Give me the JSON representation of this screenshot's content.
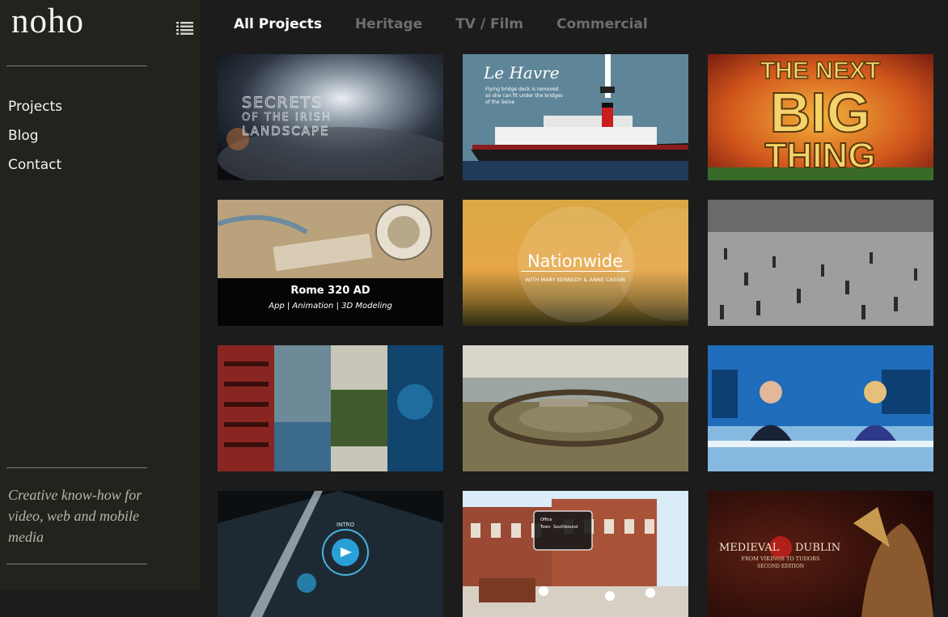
{
  "brand": {
    "logo_text": "noho"
  },
  "sidebar": {
    "nav": [
      {
        "label": "Projects"
      },
      {
        "label": "Blog"
      },
      {
        "label": "Contact"
      }
    ],
    "tagline": "Creative know-how for video, web and mobile media"
  },
  "filters": [
    {
      "label": "All Projects",
      "active": true
    },
    {
      "label": "Heritage",
      "active": false
    },
    {
      "label": "TV / Film",
      "active": false
    },
    {
      "label": "Commercial",
      "active": false
    }
  ],
  "projects": [
    {
      "thumb_text": [
        "SECRETS",
        "OF THE IRISH",
        "LANDSCAPE"
      ]
    },
    {
      "thumb_text": [
        "Le Havre",
        "Flying bridge deck is removed",
        "so she can fit under the bridges",
        "of the Seine"
      ]
    },
    {
      "thumb_text": [
        "THE NEXT",
        "BIG",
        "THING"
      ]
    },
    {
      "caption_title": "Rome 320 AD",
      "caption_sub": "App | Animation | 3D Modeling"
    },
    {
      "thumb_text": [
        "Nationwide",
        "WITH MARY KENNEDY & ANNE CASSIN"
      ]
    },
    {
      "thumb_text": []
    },
    {
      "thumb_text": []
    },
    {
      "thumb_text": []
    },
    {
      "thumb_text": []
    },
    {
      "thumb_text": [
        "INTRO"
      ]
    },
    {
      "thumb_text": [
        "Office",
        "Town",
        "Southbound"
      ]
    },
    {
      "thumb_text": [
        "MEDIEVAL",
        "DUBLIN",
        "FROM VIKINGS TO TUDORS",
        "SECOND EDITION"
      ]
    }
  ],
  "icons": {
    "menu_toggle": "list-menu-icon"
  },
  "colors": {
    "sidebar_bg": "#22231c",
    "page_bg": "#1c1c1c",
    "active_tab": "#ffffff",
    "inactive_tab": "#6e6e6e"
  }
}
